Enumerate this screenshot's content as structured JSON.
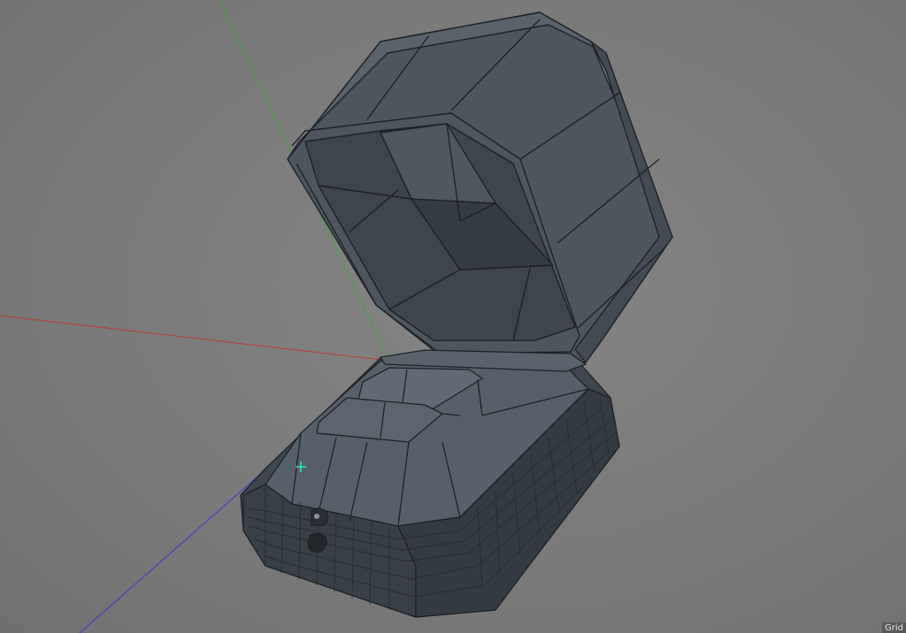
{
  "viewport": {
    "grid_label": "Grid"
  },
  "colors": {
    "background": "#7b7b7b",
    "mesh_fill": "#4a525c",
    "mesh_fill_light": "#5b636d",
    "mesh_fill_dark": "#3a4048",
    "wire": "#1e2226",
    "axis_x": "#c03a30",
    "axis_y": "#3aa83a",
    "axis_z": "#3a3ad0",
    "cursor": "#2ee0b0"
  },
  "icons": {
    "cursor": "crosshair-cursor-icon"
  }
}
